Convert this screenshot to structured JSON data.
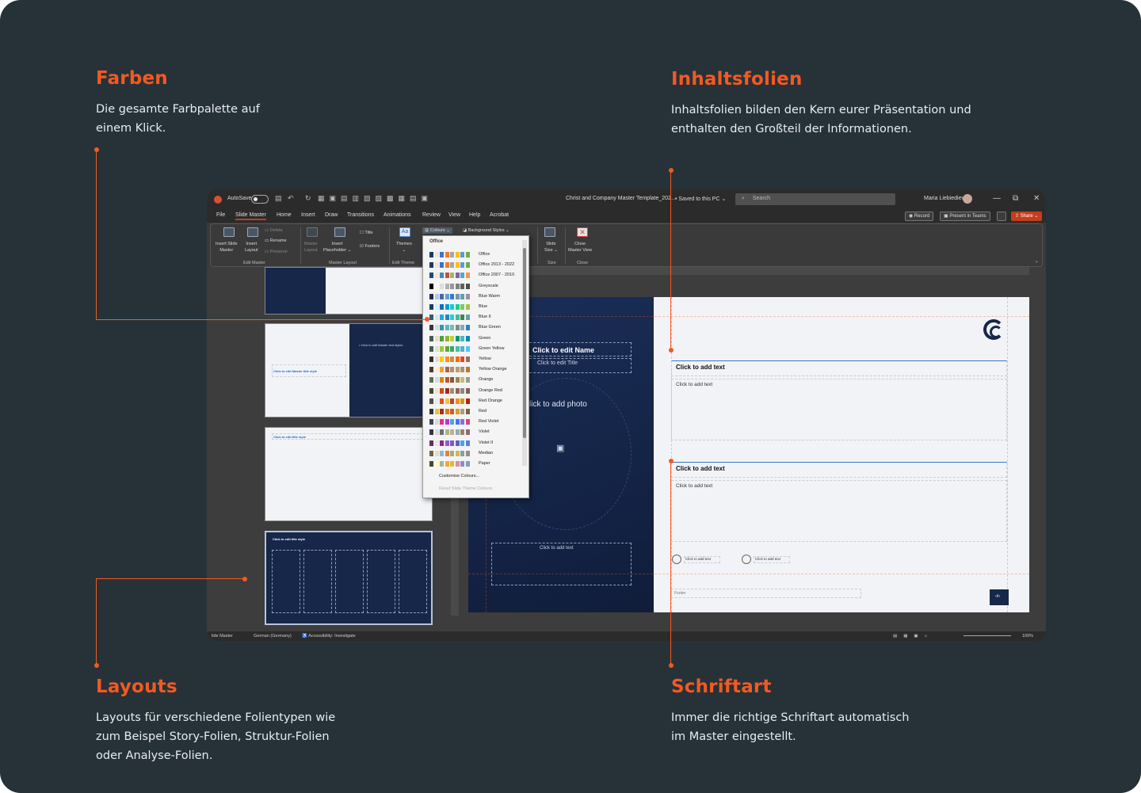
{
  "callouts": {
    "farben": {
      "title": "Farben",
      "text_l1": "Die gesamte Farbpalette auf",
      "text_l2": "einem Klick."
    },
    "inhaltsfolien": {
      "title": "Inhaltsfolien",
      "text_l1": "Inhaltsfolien bilden den Kern eurer Präsentation und",
      "text_l2": "enthalten den Großteil der Informationen."
    },
    "layouts": {
      "title": "Layouts",
      "text_l1": "Layouts für verschiedene Folientypen wie",
      "text_l2": "zum Beispel Story-Folien, Struktur-Folien",
      "text_l3": "oder Analyse-Folien."
    },
    "schriftart": {
      "title": "Schriftart",
      "text_l1": "Immer die richtige Schriftart automatisch",
      "text_l2": "im Master eingestellt."
    }
  },
  "colors": {
    "accent": "#f15a24",
    "background": "#263238",
    "navy": "#16274a",
    "ppt_orange": "#c43e1c"
  },
  "titlebar": {
    "autosave": "AutoSave",
    "doc_title": "Christ and Company Master Template_202...",
    "saved": "• Saved to this PC ⌄",
    "search_placeholder": "Search",
    "user": "Maria Liebiedieva",
    "minimize": "—",
    "restore": "⧉",
    "close": "✕"
  },
  "menu": {
    "items": [
      "File",
      "Slide Master",
      "Home",
      "Insert",
      "Draw",
      "Transitions",
      "Animations",
      "Review",
      "View",
      "Help",
      "Acrobat"
    ],
    "record": "Record",
    "present": "Present in Teams",
    "share": "Share ⌄"
  },
  "ribbon": {
    "insert_slide_master": "Insert Slide",
    "insert_slide_master_2": "Master",
    "insert_layout": "Insert",
    "insert_layout_2": "Layout",
    "delete": "Delete",
    "rename": "Rename",
    "preserve": "Preserve",
    "group_edit_master": "Edit Master",
    "master_layout": "Master",
    "master_layout_2": "Layout",
    "insert_placeholder": "Insert",
    "insert_placeholder_2": "Placeholder ⌄",
    "title": "Title",
    "footers": "Footers",
    "group_master_layout": "Master Layout",
    "themes": "Themes",
    "group_edit_theme": "Edit Theme",
    "colours": "Colours ⌄",
    "background_styles": "Background Styles ⌄",
    "slide_size": "Slide",
    "slide_size_2": "Size ⌄",
    "group_size": "Size",
    "close_master": "Close",
    "close_master_2": "Master View",
    "group_close": "Close"
  },
  "dropdown": {
    "header": "Office",
    "themes": [
      "Office",
      "Office 2013 - 2022",
      "Office 2007 - 2010",
      "Greyscale",
      "Blue Warm",
      "Blue",
      "Blue II",
      "Blue Green",
      "Green",
      "Green Yellow",
      "Yellow",
      "Yellow Orange",
      "Orange",
      "Orange Red",
      "Red Orange",
      "Red",
      "Red Violet",
      "Violet",
      "Violet II",
      "Median",
      "Paper"
    ],
    "customise": "Customise Colours...",
    "reset": "Reset Slide Theme Colours"
  },
  "thumbnails": {
    "t2_title": "Click to edit Master title style",
    "t2_text": "• Click to edit Master text styles",
    "t3_title": "Click to edit title style",
    "t4_title": "Click to edit title style"
  },
  "slide": {
    "name": "Click to edit Name",
    "title": "Click to edit Title",
    "photo": "lick to add photo",
    "left_text": "Click to add text",
    "r1_heading": "Click to add text",
    "r1_body": "Click to add text",
    "r2_heading": "Click to add text",
    "r2_body": "Click to add text",
    "icon1_text": "Click to add text",
    "icon2_text": "Click to add text",
    "footer": "Footer",
    "page_num": "‹#›"
  },
  "statusbar": {
    "view": "lide Master",
    "language": "German (Germany)",
    "accessibility": "Accessibility: Investigate",
    "zoom": "100%"
  }
}
